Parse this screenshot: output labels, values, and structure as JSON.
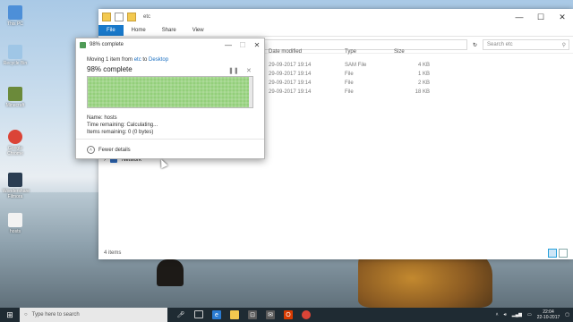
{
  "desktop": {
    "icons": [
      {
        "label": "This PC",
        "icon": "this-pc-icon",
        "color": "#4d8fd8"
      },
      {
        "label": "Recycle Bin",
        "icon": "recycle-bin-icon",
        "color": "#9fc6e6"
      },
      {
        "label": "Minecraft",
        "icon": "minecraft-icon",
        "color": "#6b8a3a"
      },
      {
        "label": "Google Chrome",
        "icon": "chrome-icon",
        "color": "#db4437"
      },
      {
        "label": "Wondershare Filmora",
        "icon": "filmora-icon",
        "color": "#2a3d52"
      },
      {
        "label": "hosts",
        "icon": "file-icon",
        "color": "#f2f2f2"
      }
    ]
  },
  "explorer": {
    "title": "etc",
    "window_controls": [
      "—",
      "☐",
      "✕"
    ],
    "ribbon_tabs": [
      "File",
      "Home",
      "Share",
      "View"
    ],
    "address": "rivers  ›  etc",
    "search_placeholder": "Search etc",
    "columns": [
      "Date modified",
      "Type",
      "Size"
    ],
    "rows": [
      {
        "date": "29-09-2017 19:14",
        "type": "SAM File",
        "size": "4 KB"
      },
      {
        "date": "29-09-2017 19:14",
        "type": "File",
        "size": "1 KB"
      },
      {
        "date": "29-09-2017 19:14",
        "type": "File",
        "size": "2 KB"
      },
      {
        "date": "29-09-2017 19:14",
        "type": "File",
        "size": "18 KB"
      }
    ],
    "nav_network": "Network",
    "status": "4 items"
  },
  "dialog": {
    "title": "98% complete",
    "moving_prefix": "Moving 1 item from ",
    "source": "etc",
    "moving_mid": " to ",
    "destination": "Desktop",
    "percent_text": "98% complete",
    "progress": 0.98,
    "name": "Name:  hosts",
    "time_remaining": "Time remaining:  Calculating...",
    "items_remaining": "Items remaining:  0 (0 bytes)",
    "fewer_details": "Fewer details",
    "accent": "#93cf7a"
  },
  "taskbar": {
    "search_placeholder": "Type here to search",
    "time": "22:04",
    "date": "22-10-2017"
  }
}
